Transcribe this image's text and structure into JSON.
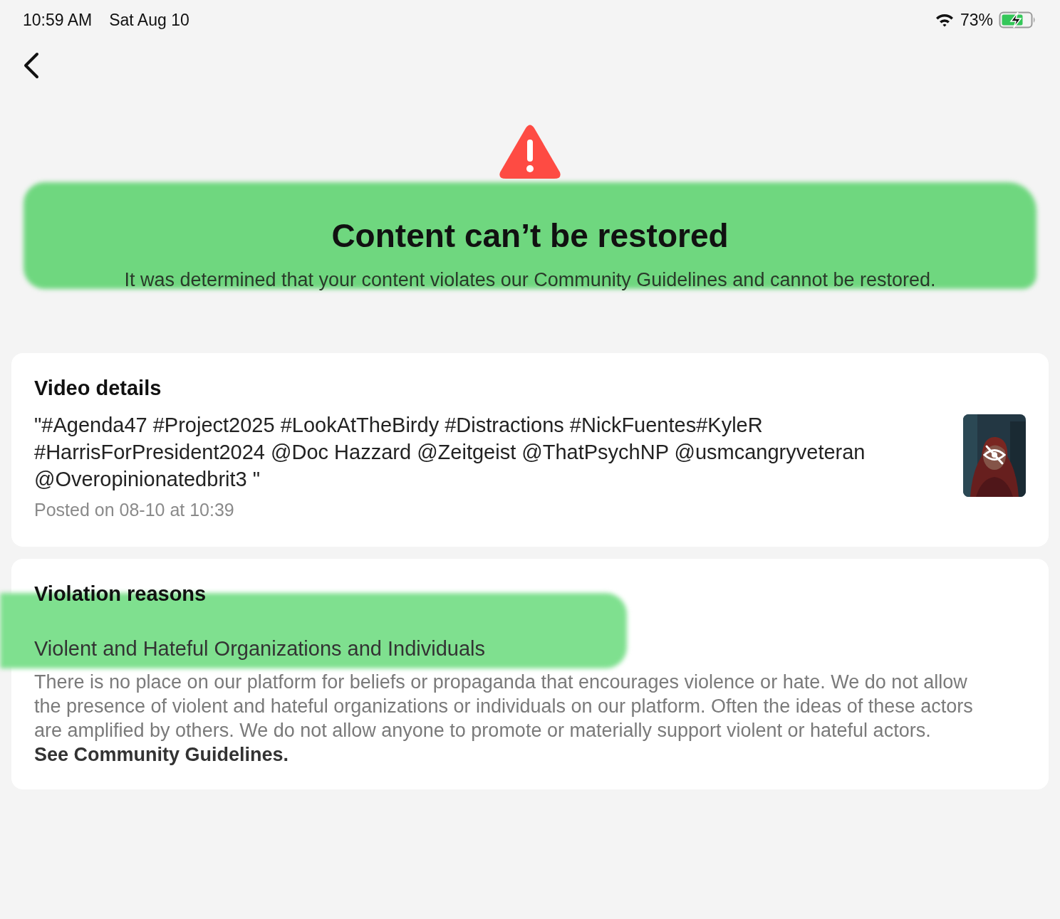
{
  "status_bar": {
    "time": "10:59 AM",
    "date": "Sat Aug 10",
    "battery": "73%",
    "charging": true
  },
  "header": {
    "title": "Content can’t be restored",
    "message": "It was determined that your content violates our Community Guidelines and cannot be restored.",
    "highlighted": true
  },
  "video_details": {
    "heading": "Video details",
    "caption": "\"#Agenda47 #Project2025 #LookAtTheBirdy #Distractions #NickFuentes#KyleR #HarrisForPresident2024 @Doc Hazzard @Zeitgeist @ThatPsychNP @usmcangryveteran @Overopinionatedbrit3 \"",
    "posted": "Posted on 08-10 at 10:39",
    "thumbnail": {
      "kind": "picture",
      "hidden": true
    }
  },
  "violation": {
    "heading": "Violation reasons",
    "reason": "Violent and Hateful Organizations and Individuals",
    "highlighted": true,
    "description": "There is no place on our platform for beliefs or propaganda that encourages violence or hate. We do not allow the presence of violent and hateful organizations or individuals on our platform. Often the ideas of these actors are amplified by others. We do not allow anyone to promote or materially support violent or hateful actors.",
    "link": "See Community Guidelines."
  }
}
